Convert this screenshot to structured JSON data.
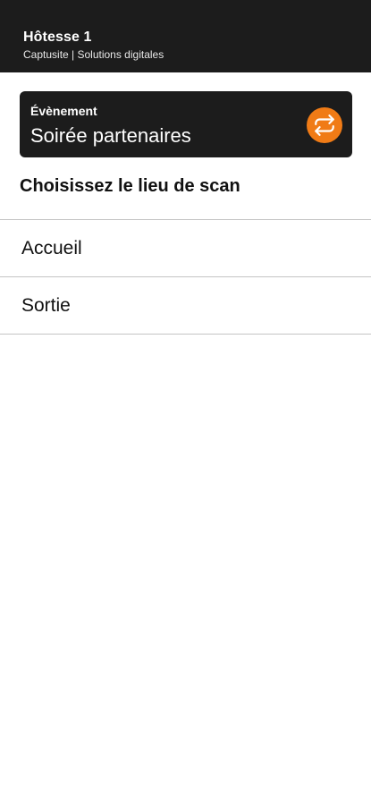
{
  "header": {
    "user_name": "Hôtesse 1",
    "subtitle": "Captusite | Solutions digitales"
  },
  "event": {
    "label": "Évènement",
    "name": "Soirée partenaires",
    "swap_icon": "swap-arrows-icon",
    "accent_color": "#f07b16"
  },
  "scan": {
    "title": "Choisissez le lieu de scan",
    "locations": [
      {
        "label": "Accueil"
      },
      {
        "label": "Sortie"
      }
    ]
  }
}
